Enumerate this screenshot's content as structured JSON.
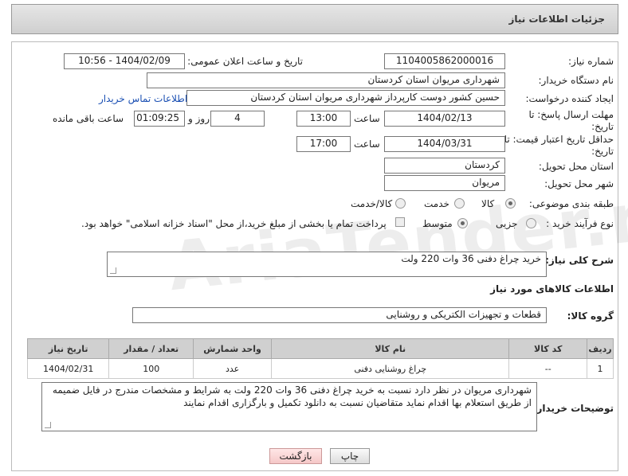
{
  "header": {
    "title": "جزئیات اطلاعات نیاز"
  },
  "fields": {
    "need_number_label": "شماره نیاز:",
    "need_number": "1104005862000016",
    "announce_label": "تاریخ و ساعت اعلان عمومی:",
    "announce_value": "1404/02/09 - 10:56",
    "buyer_org_label": "نام دستگاه خریدار:",
    "buyer_org": "شهرداری مریوان استان کردستان",
    "creator_label": "ایجاد کننده درخواست:",
    "creator": "حسین کشور دوست کارپرداز شهرداری مریوان استان کردستان",
    "contact_link": "اطلاعات تماس خریدار",
    "deadline_label": "مهلت ارسال پاسخ: تا تاریخ:",
    "deadline_date": "1404/02/13",
    "time_label": "ساعت",
    "deadline_time": "13:00",
    "days_value": "4",
    "days_label": "روز و",
    "remaining_time": "01:09:25",
    "remaining_label": "ساعت باقی مانده",
    "min_valid_label": "حداقل تاریخ اعتبار قیمت: تا تاریخ:",
    "min_valid_date": "1404/03/31",
    "min_valid_time": "17:00",
    "province_label": "استان محل تحویل:",
    "province": "کردستان",
    "city_label": "شهر محل تحویل:",
    "city": "مریوان",
    "category_label": "طبقه بندی موضوعی:",
    "category_options": [
      "کالا",
      "خدمت",
      "کالا/خدمت"
    ],
    "process_label": "نوع فرآیند خرید :",
    "process_options": [
      "جزیی",
      "متوسط"
    ],
    "payment_note": "پرداخت تمام یا بخشی از مبلغ خرید،از محل \"اسناد خزانه اسلامی\" خواهد بود."
  },
  "description": {
    "label": "شرح کلی نیاز:",
    "value": "خرید چراغ دفنی 36 وات 220 ولت"
  },
  "goods": {
    "section_title": "اطلاعات کالاهای مورد نیاز",
    "group_label": "گروه کالا:",
    "group_value": "قطعات و تجهیزات الکتریکی و روشنایی",
    "columns": [
      "ردیف",
      "کد کالا",
      "نام کالا",
      "واحد شمارش",
      "تعداد / مقدار",
      "تاریخ نیاز"
    ],
    "rows": [
      [
        "1",
        "--",
        "چراغ روشنایی دفنی",
        "عدد",
        "100",
        "1404/02/31"
      ]
    ]
  },
  "buyer_notes": {
    "label": "توضیحات خریدار:",
    "value": "شهرداری مریوان در نظر دارد نسبت به خرید چراغ دفنی 36 وات 220 ولت به شرایط و مشخصات مندرج در فایل ضمیمه از طریق استعلام بها اقدام نماید متقاضیان نسبت به دانلود تکمیل و بارگزاری اقدام نمایند"
  },
  "buttons": {
    "print": "چاپ",
    "back": "بازگشت"
  }
}
